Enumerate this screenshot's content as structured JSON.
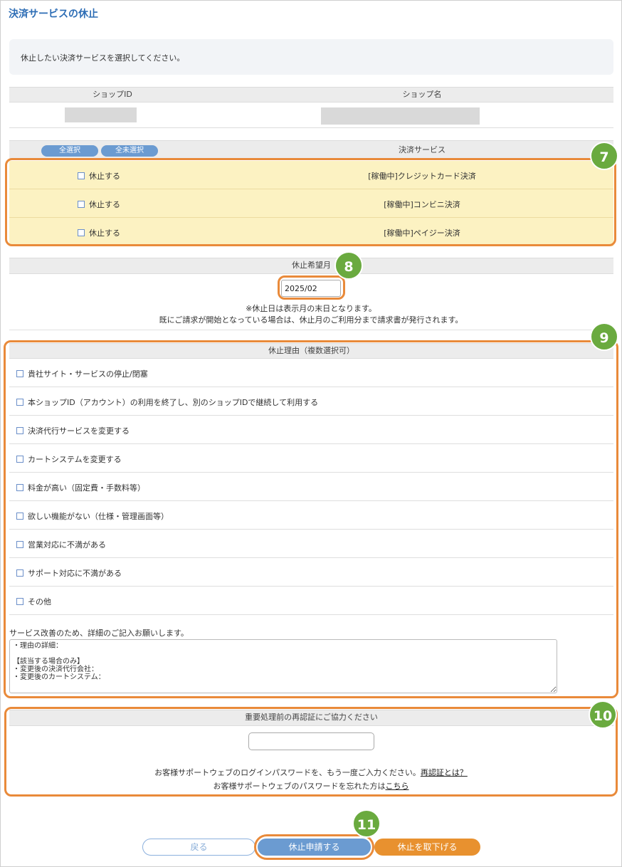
{
  "page_title": "決済サービスの休止",
  "instruction": "休止したい決済サービスを選択してください。",
  "shop_table": {
    "col_id": "ショップID",
    "col_name": "ショップ名"
  },
  "services": {
    "select_all": "全選択",
    "deselect_all": "全未選択",
    "header": "決済サービス",
    "check_label": "休止する",
    "items": [
      {
        "name": "[稼働中]クレジットカード決済"
      },
      {
        "name": "[稼働中]コンビニ決済"
      },
      {
        "name": "[稼働中]ペイジー決済"
      }
    ]
  },
  "month": {
    "header": "休止希望月",
    "value": "2025/02",
    "note1": "※休止日は表示月の末日となります。",
    "note2": "既にご請求が開始となっている場合は、休止月のご利用分まで請求書が発行されます。"
  },
  "reasons": {
    "header": "休止理由（複数選択可）",
    "items": [
      "貴社サイト・サービスの停止/閉塞",
      "本ショップID（アカウント）の利用を終了し、別のショップIDで継続して利用する",
      "決済代行サービスを変更する",
      "カートシステムを変更する",
      "料金が高い（固定費・手数料等）",
      "欲しい機能がない（仕様・管理画面等）",
      "営業対応に不満がある",
      "サポート対応に不満がある",
      "その他"
    ],
    "detail_prompt": "サービス改善のため、詳細のご記入お願いします。",
    "detail_text": "・理由の詳細：\n\n【該当する場合のみ】\n・変更後の決済代行会社：\n・変更後のカートシステム："
  },
  "reauth": {
    "header": "重要処理前の再認証にご協力ください",
    "message": "お客様サポートウェブのログインパスワードを、もう一度ご入力ください。",
    "what_link": "再認証とは？",
    "forgot_text": "お客様サポートウェブのパスワードを忘れた方は",
    "forgot_link": "こちら"
  },
  "buttons": {
    "back": "戻る",
    "apply": "休止申請する",
    "withdraw": "休止を取下げる"
  },
  "badges": {
    "b7": "7",
    "b8": "8",
    "b9": "9",
    "b10": "10",
    "b11": "11"
  },
  "colors": {
    "accent_orange": "#e98a3a",
    "badge_green": "#6aaa3f",
    "service_row": "#fcf2c2",
    "primary_blue": "#6b9bd1"
  }
}
